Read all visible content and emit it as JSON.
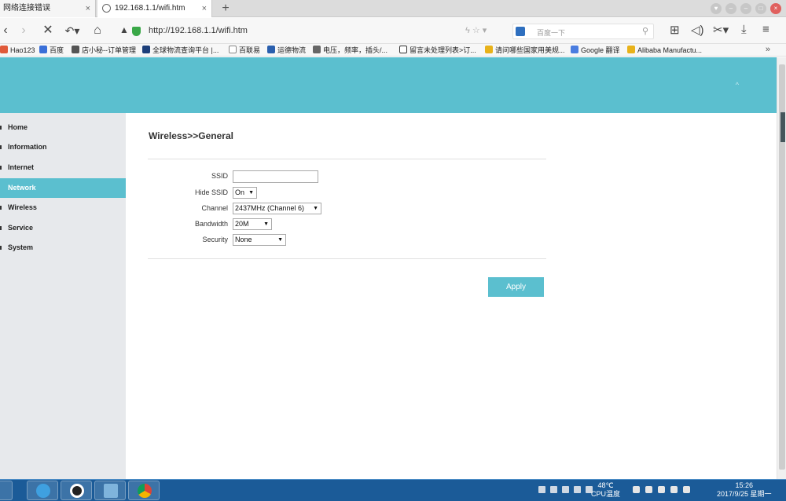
{
  "browser": {
    "tabs": [
      {
        "label": "网络连接错误",
        "close": "×"
      },
      {
        "label": "192.168.1.1/wifi.htm",
        "close": "×"
      }
    ],
    "new_tab": "+",
    "url": "http://192.168.1.1/wifi.htm",
    "search_placeholder": "百度一下",
    "bookmarks": [
      {
        "label": "Hao123",
        "color": "#e05a3a"
      },
      {
        "label": "百度",
        "color": "#3a6fd8"
      },
      {
        "label": "店小秘--订单管理",
        "color": "#555555"
      },
      {
        "label": "全球物流查询平台 |...",
        "color": "#1d3f7a"
      },
      {
        "label": "百联易",
        "color": "#888888"
      },
      {
        "label": "运德物流",
        "color": "#2a5fae"
      },
      {
        "label": "电压，频率，插头/...",
        "color": "#666666"
      },
      {
        "label": "留言未处理列表>订...",
        "color": "#333333"
      },
      {
        "label": "请问哪些国家用美规...",
        "color": "#e8b21a"
      },
      {
        "label": "Google 翻译",
        "color": "#4a7de0"
      },
      {
        "label": "Alibaba Manufactu...",
        "color": "#e8b21a"
      }
    ],
    "bookmarks_more": "»"
  },
  "sidebar": {
    "items": [
      {
        "label": "Home",
        "active": false
      },
      {
        "label": "Information",
        "active": false
      },
      {
        "label": "Internet",
        "active": false
      },
      {
        "label": "Network",
        "active": true
      },
      {
        "label": "Wireless",
        "active": false
      },
      {
        "label": "Service",
        "active": false
      },
      {
        "label": "System",
        "active": false
      }
    ]
  },
  "page": {
    "title": "Wireless>>General",
    "fields": {
      "ssid": {
        "label": "SSID",
        "value": ""
      },
      "hide_ssid": {
        "label": "Hide SSID",
        "value": "On"
      },
      "channel": {
        "label": "Channel",
        "value": "2437MHz (Channel 6)"
      },
      "bandwidth": {
        "label": "Bandwidth",
        "value": "20M"
      },
      "security": {
        "label": "Security",
        "value": "None"
      }
    },
    "apply_label": "Apply"
  },
  "taskbar": {
    "temp": "48℃",
    "temp_label": "CPU温度",
    "time": "15:26",
    "date": "2017/9/25 星期一"
  },
  "colors": {
    "accent": "#5bbfcf",
    "sidebar_bg": "#e7e9ec",
    "taskbar": "#1b5b98"
  }
}
